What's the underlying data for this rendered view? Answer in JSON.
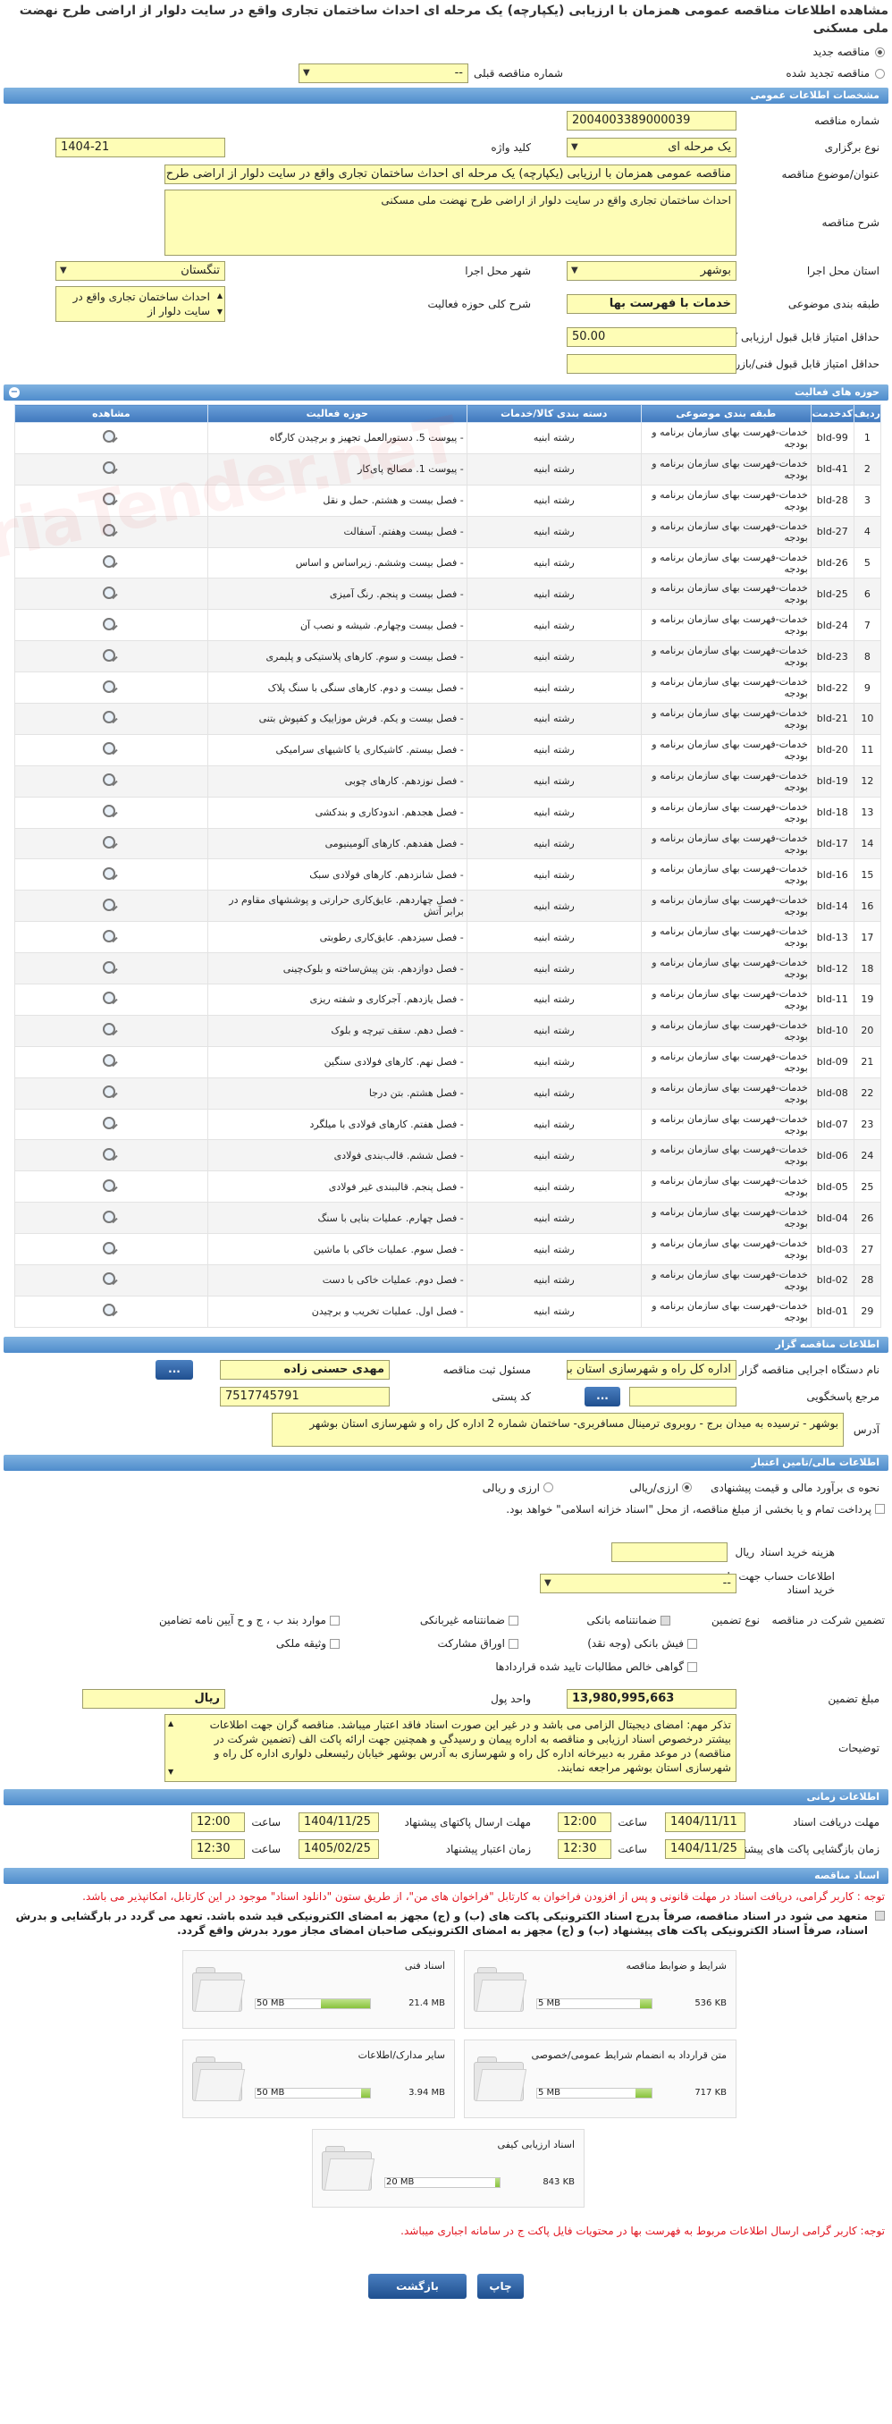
{
  "page_title": "مشاهده اطلاعات مناقصه عمومی همزمان با ارزیابی (یکپارچه) یک مرحله ای احداث ساختمان تجاری واقع در سایت دلوار از اراضی طرح نهضت ملی مسکنی",
  "type_options": {
    "new": "مناقصه جدید",
    "renewed": "مناقصه تجدید شده",
    "prev_no_label": "شماره مناقصه قبلی",
    "prev_no_value": "--"
  },
  "general": {
    "section_title": "مشخصات اطلاعات عمومی",
    "tender_no_label": "شماره مناقصه",
    "tender_no": "2004003389000039",
    "holding_type_label": "نوع برگزاری",
    "holding_type": "یک مرحله ای",
    "keyword_label": "کلید واژه",
    "keyword": "1404-21",
    "subject_label": "عنوان/موضوع مناقصه",
    "subject": "مناقصه عمومی همزمان با ارزیابی (یکپارچه) یک مرحله ای احداث ساختمان تجاری واقع در سایت دلوار از اراضی طرح نهضت ملی مسکنی",
    "desc_label": "شرح مناقصه",
    "desc": "احداث ساختمان تجاری واقع در سایت دلوار از اراضی طرح نهضت ملی مسکنی",
    "province_label": "استان محل اجرا",
    "province": "بوشهر",
    "city_label": "شهر محل اجرا",
    "city": "تنگستان",
    "category_label": "طبقه بندی موضوعی",
    "category": "خدمات با فهرست بها",
    "scope_label": "شرح کلی حوزه فعالیت",
    "scope": "احداث ساختمان تجاری واقع در سایت دلوار از",
    "min_quality_label": "حداقل امتیاز قابل قبول ارزیابی کیفی",
    "min_quality": "50.00",
    "min_tech_label": "حداقل امتیاز قابل قبول فنی/بازرگانی",
    "min_tech": ""
  },
  "activities": {
    "section_title": "حوزه های فعالیت",
    "headers": [
      "ردیف",
      "کدخدمت",
      "طبقه بندی موضوعی",
      "دسته بندی کالا/خدمات",
      "حوزه فعالیت",
      "مشاهده"
    ],
    "rows": [
      {
        "n": "1",
        "code": "bld-99",
        "cat": "خدمات-فهرست بهای سازمان برنامه و بودجه",
        "group": "رشته ابنیه",
        "field": "- پیوست 5. دستورالعمل تجهیز و برچیدن کارگاه"
      },
      {
        "n": "2",
        "code": "bld-41",
        "cat": "خدمات-فهرست بهای سازمان برنامه و بودجه",
        "group": "رشته ابنیه",
        "field": "- پیوست 1. مصالح پای‌کار"
      },
      {
        "n": "3",
        "code": "bld-28",
        "cat": "خدمات-فهرست بهای سازمان برنامه و بودجه",
        "group": "رشته ابنیه",
        "field": "- فصل بیست و هشتم. حمل و نقل"
      },
      {
        "n": "4",
        "code": "bld-27",
        "cat": "خدمات-فهرست بهای سازمان برنامه و بودجه",
        "group": "رشته ابنیه",
        "field": "- فصل بیست وهفتم. آسفالت"
      },
      {
        "n": "5",
        "code": "bld-26",
        "cat": "خدمات-فهرست بهای سازمان برنامه و بودجه",
        "group": "رشته ابنیه",
        "field": "- فصل بیست وششم. زیراساس و اساس"
      },
      {
        "n": "6",
        "code": "bld-25",
        "cat": "خدمات-فهرست بهای سازمان برنامه و بودجه",
        "group": "رشته ابنیه",
        "field": "- فصل بیست و پنجم. رنگ آمیزی"
      },
      {
        "n": "7",
        "code": "bld-24",
        "cat": "خدمات-فهرست بهای سازمان برنامه و بودجه",
        "group": "رشته ابنیه",
        "field": "- فصل بیست وچهارم. شیشه و نصب آن"
      },
      {
        "n": "8",
        "code": "bld-23",
        "cat": "خدمات-فهرست بهای سازمان برنامه و بودجه",
        "group": "رشته ابنیه",
        "field": "- فصل بیست و سوم. کارهای پلاستیکی و پلیمری"
      },
      {
        "n": "9",
        "code": "bld-22",
        "cat": "خدمات-فهرست بهای سازمان برنامه و بودجه",
        "group": "رشته ابنیه",
        "field": "- فصل بیست و دوم. کارهای سنگی با سنگ پلاک"
      },
      {
        "n": "10",
        "code": "bld-21",
        "cat": "خدمات-فهرست بهای سازمان برنامه و بودجه",
        "group": "رشته ابنیه",
        "field": "- فصل بیست و یکم. فرش موزاییک و کفپوش بتنی"
      },
      {
        "n": "11",
        "code": "bld-20",
        "cat": "خدمات-فهرست بهای سازمان برنامه و بودجه",
        "group": "رشته ابنیه",
        "field": "- فصل بیستم. کاشیکاری یا کاشیهای سرامیکی"
      },
      {
        "n": "12",
        "code": "bld-19",
        "cat": "خدمات-فهرست بهای سازمان برنامه و بودجه",
        "group": "رشته ابنیه",
        "field": "- فصل نوزدهم. کارهای چوبی"
      },
      {
        "n": "13",
        "code": "bld-18",
        "cat": "خدمات-فهرست بهای سازمان برنامه و بودجه",
        "group": "رشته ابنیه",
        "field": "- فصل هجدهم. اندودکاری و بندکشی"
      },
      {
        "n": "14",
        "code": "bld-17",
        "cat": "خدمات-فهرست بهای سازمان برنامه و بودجه",
        "group": "رشته ابنیه",
        "field": "- فصل هفدهم. کارهای آلومینیومی"
      },
      {
        "n": "15",
        "code": "bld-16",
        "cat": "خدمات-فهرست بهای سازمان برنامه و بودجه",
        "group": "رشته ابنیه",
        "field": "- فصل شانزدهم. کارهای فولادی سبک"
      },
      {
        "n": "16",
        "code": "bld-14",
        "cat": "خدمات-فهرست بهای سازمان برنامه و بودجه",
        "group": "رشته ابنیه",
        "field": "- فصل چهاردهم. عایق‌کاری حرارتی و پوششهای مقاوم در برابر آتش"
      },
      {
        "n": "17",
        "code": "bld-13",
        "cat": "خدمات-فهرست بهای سازمان برنامه و بودجه",
        "group": "رشته ابنیه",
        "field": "- فصل سیزدهم. عایق‌کاری رطوبتی"
      },
      {
        "n": "18",
        "code": "bld-12",
        "cat": "خدمات-فهرست بهای سازمان برنامه و بودجه",
        "group": "رشته ابنیه",
        "field": "- فصل دوازدهم. بتن پیش‌ساخته و بلوک‌چینی"
      },
      {
        "n": "19",
        "code": "bld-11",
        "cat": "خدمات-فهرست بهای سازمان برنامه و بودجه",
        "group": "رشته ابنیه",
        "field": "- فصل یازدهم. آجرکاری و شفته ریزی"
      },
      {
        "n": "20",
        "code": "bld-10",
        "cat": "خدمات-فهرست بهای سازمان برنامه و بودجه",
        "group": "رشته ابنیه",
        "field": "- فصل دهم. سقف تیرچه و بلوک"
      },
      {
        "n": "21",
        "code": "bld-09",
        "cat": "خدمات-فهرست بهای سازمان برنامه و بودجه",
        "group": "رشته ابنیه",
        "field": "- فصل نهم. کارهای فولادی سنگین"
      },
      {
        "n": "22",
        "code": "bld-08",
        "cat": "خدمات-فهرست بهای سازمان برنامه و بودجه",
        "group": "رشته ابنیه",
        "field": "- فصل هشتم. بتن درجا"
      },
      {
        "n": "23",
        "code": "bld-07",
        "cat": "خدمات-فهرست بهای سازمان برنامه و بودجه",
        "group": "رشته ابنیه",
        "field": "- فصل هفتم. کارهای فولادی با میلگرد"
      },
      {
        "n": "24",
        "code": "bld-06",
        "cat": "خدمات-فهرست بهای سازمان برنامه و بودجه",
        "group": "رشته ابنیه",
        "field": "- فصل ششم. قالب‌بندی فولادی"
      },
      {
        "n": "25",
        "code": "bld-05",
        "cat": "خدمات-فهرست بهای سازمان برنامه و بودجه",
        "group": "رشته ابنیه",
        "field": "- فصل پنجم. قالببندی غیر فولادی"
      },
      {
        "n": "26",
        "code": "bld-04",
        "cat": "خدمات-فهرست بهای سازمان برنامه و بودجه",
        "group": "رشته ابنیه",
        "field": "- فصل چهارم. عملیات بنایی با سنگ"
      },
      {
        "n": "27",
        "code": "bld-03",
        "cat": "خدمات-فهرست بهای سازمان برنامه و بودجه",
        "group": "رشته ابنیه",
        "field": "- فصل سوم. عملیات خاکی با ماشین"
      },
      {
        "n": "28",
        "code": "bld-02",
        "cat": "خدمات-فهرست بهای سازمان برنامه و بودجه",
        "group": "رشته ابنیه",
        "field": "- فصل دوم. عملیات خاکی با دست"
      },
      {
        "n": "29",
        "code": "bld-01",
        "cat": "خدمات-فهرست بهای سازمان برنامه و بودجه",
        "group": "رشته ابنیه",
        "field": "- فصل اول. عملیات تخریب و برچیدن"
      }
    ]
  },
  "organizer": {
    "section_title": "اطلاعات مناقصه گزار",
    "org_label": "نام دستگاه اجرایی مناقصه گزار",
    "org": "اداره کل راه و شهرسازی استان بوشهر",
    "resp_label": "مسئول ثبت مناقصه",
    "resp": "مهدی حسنی زاده",
    "ref_label": "مرجع پاسخگویی",
    "ref": "",
    "postal_label": "کد پستی",
    "postal": "7517745791",
    "addr_label": "آدرس",
    "addr": "بوشهر - ترسیده به میدان برج - روبروی ترمینال مسافربری- ساختمان شماره 2 اداره کل راه و شهرسازی استان بوشهر",
    "more_btn": "..."
  },
  "finance": {
    "section_title": "اطلاعات مالی/تامین اعتبار",
    "estimate_label": "نحوه ی برآورد مالی و قیمت پیشنهادی",
    "estimate_opt1": "ارزی/ریالی",
    "estimate_opt2": "ارزی و ریالی",
    "pay_text": "پرداخت تمام و یا بخشی از مبلغ مناقصه، از محل \"اسناد خزانه اسلامی\" خواهد بود.",
    "doc_fee_label": "هزینه خرید اسناد",
    "doc_fee_unit": "ریال",
    "doc_fee": "",
    "account_label": "اطلاعات حساب جهت واریز هزینه خرید اسناد",
    "account": "--",
    "guarantee_label": "تضمین شرکت در مناقصه",
    "guarantee_type_label": "نوع تضمین",
    "g1": "ضمانتنامه بانکی",
    "g2": "ضمانتنامه غیربانکی",
    "g3": "موارد بند ب ، ج و ح آیین نامه تضامین",
    "g4": "فیش بانکی (وجه نقد)",
    "g5": "اوراق مشارکت",
    "g6": "وثیقه ملکی",
    "g7": "گواهی خالص مطالبات تایید شده قراردادها",
    "amount_label": "مبلغ تضمین",
    "amount": "13,980,995,663",
    "currency_label": "واحد پول",
    "currency": "ریال",
    "desc_label": "توضیحات",
    "desc": "تذکر مهم: امضای دیجیتال الزامی می باشد و در غیر این صورت اسناد فاقد اعتبار میباشد. مناقصه گران جهت اطلاعات بیشتر درخصوص اسناد ارزیابی و مناقصه به اداره پیمان و رسیدگی و همچنین جهت ارائه پاکت الف (تضمین شرکت در مناقصه) در موعد مقرر به دبیرخانه اداره کل راه و شهرسازی به آدرس بوشهر خیابان رئیسعلی دلواری اداره کل راه و شهرسازی استان بوشهر مراجعه نمایند."
  },
  "timing": {
    "section_title": "اطلاعات زمانی",
    "receive_label": "مهلت دریافت اسناد",
    "receive_date": "1404/11/11",
    "receive_time": "12:00",
    "send_label": "مهلت ارسال پاکتهای پیشنهاد",
    "send_date": "1404/11/25",
    "send_time": "12:00",
    "open_label": "زمان بازگشایی پاکت های پیشنهاد",
    "open_date": "1404/11/25",
    "open_time": "12:30",
    "validity_label": "زمان اعتبار پیشنهاد",
    "validity_date": "1405/02/25",
    "validity_time": "12:30",
    "time_label": "ساعت"
  },
  "docs": {
    "section_title": "اسناد مناقصه",
    "note1": "توجه : کاربر گرامی، دریافت اسناد در مهلت قانونی و پس از افزودن فراخوان به کارتابل \"فراخوان های من\"، از طریق ستون \"دانلود اسناد\" موجود در این کارتابل، امکانپذیر می باشد.",
    "note2": "متعهد می شود در اسناد مناقصه، صرفاً بدرج اسناد الکترونیکی پاکت های (ب) و (ج) مجهز به امضای الکترونیکی قید شده باشد. تعهد می گردد در بارگشایی و بدرش اسناد، صرفاً اسناد الکترونیکی پاکت های پیشنهاد (ب) و (ج) مجهز به امضای الکترونیکی صاحبان امضای مجاز مورد بدرش واقع گردد.",
    "cards": [
      {
        "title": "شرایط و ضوابط مناقصه",
        "used": "536 KB",
        "limit": "5 MB",
        "fill": 0.1
      },
      {
        "title": "اسناد فنی",
        "used": "21.4 MB",
        "limit": "50 MB",
        "fill": 0.43
      },
      {
        "title": "متن قرارداد به انضمام شرایط عمومی/خصوصی",
        "used": "717 KB",
        "limit": "5 MB",
        "fill": 0.14
      },
      {
        "title": "سایر مدارک/اطلاعات",
        "used": "3.94 MB",
        "limit": "50 MB",
        "fill": 0.08
      },
      {
        "title": "اسناد ارزیابی کیفی",
        "used": "843 KB",
        "limit": "20 MB",
        "fill": 0.04
      }
    ],
    "note3": "توجه: کاربر گرامی ارسال اطلاعات مربوط به فهرست بها در محتویات فایل پاکت ج در سامانه اجباری میباشد."
  },
  "footer": {
    "print_btn": "چاپ",
    "back_btn": "بازگشت"
  },
  "colors": {
    "accent": "#4f8ccc",
    "field_bg": "#fefdb6",
    "warning": "#e0141e"
  }
}
